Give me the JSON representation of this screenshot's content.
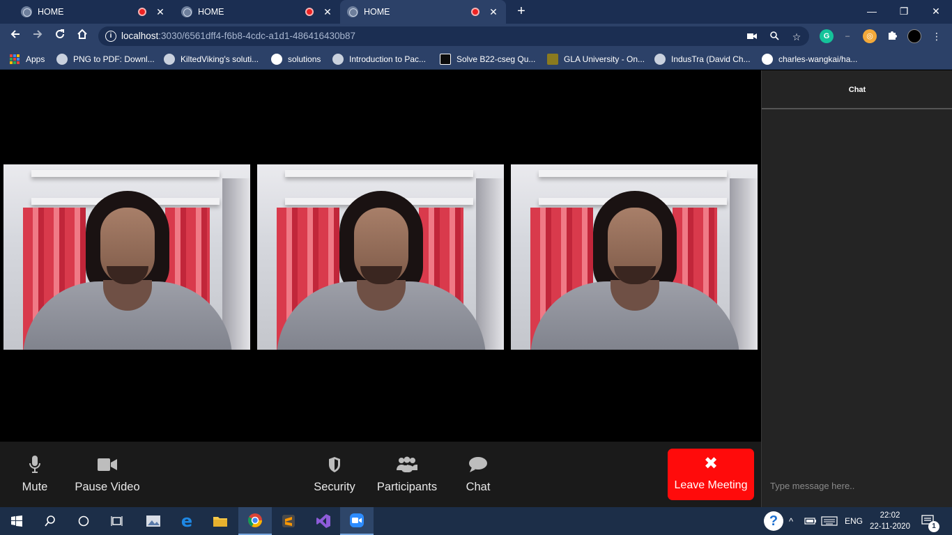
{
  "browser": {
    "tabs": [
      {
        "title": "HOME",
        "recording": true,
        "active": false
      },
      {
        "title": "HOME",
        "recording": true,
        "active": false
      },
      {
        "title": "HOME",
        "recording": true,
        "active": true
      }
    ],
    "new_tab_glyph": "+",
    "window_controls": {
      "minimize": "—",
      "restore": "❐",
      "close": "✕"
    },
    "address": {
      "host": "localhost",
      "rest": ":3030/6561dff4-f6b8-4cdc-a1d1-486416430b87"
    },
    "omnibox_icons": [
      "camera-icon",
      "zoom-icon",
      "star-icon"
    ],
    "extensions": [
      "grammarly-icon",
      "dash-icon",
      "glasses-icon",
      "puzzle-icon",
      "profile-avatar",
      "menu-icon"
    ],
    "bookmarks": [
      {
        "label": "Apps",
        "icon": "apps-grid-icon"
      },
      {
        "label": "PNG to PDF: Downl...",
        "icon": "globe-icon"
      },
      {
        "label": "KiltedViking's soluti...",
        "icon": "globe-icon"
      },
      {
        "label": "solutions",
        "icon": "github-icon"
      },
      {
        "label": "Introduction to Pac...",
        "icon": "globe-icon"
      },
      {
        "label": "Solve B22-cseg Qu...",
        "icon": "hackerrank-icon"
      },
      {
        "label": "GLA University - On...",
        "icon": "gla-icon"
      },
      {
        "label": "IndusTra (David Ch...",
        "icon": "globe-icon"
      },
      {
        "label": "charles-wangkai/ha...",
        "icon": "github-icon"
      }
    ]
  },
  "meeting": {
    "videos": [
      {
        "name": "video-tile-1"
      },
      {
        "name": "video-tile-2"
      },
      {
        "name": "video-tile-3"
      }
    ],
    "controls": {
      "mute": "Mute",
      "pause_video": "Pause Video",
      "security": "Security",
      "participants": "Participants",
      "chat": "Chat",
      "leave": "Leave Meeting",
      "leave_glyph": "✖"
    },
    "chat_panel": {
      "title": "Chat",
      "placeholder": "Type message here.."
    },
    "colors": {
      "leave_button": "#ff0b0b",
      "control_bar": "#1a1a1a",
      "chat_bg": "#242424"
    }
  },
  "taskbar": {
    "apps": [
      "windows-start-icon",
      "search-icon",
      "cortana-icon",
      "task-view-icon",
      "photos-icon",
      "edge-icon",
      "file-explorer-icon",
      "chrome-icon",
      "sublime-text-icon",
      "visual-studio-icon",
      "zoom-icon"
    ],
    "tray": {
      "language": "ENG",
      "notification_count": "1"
    },
    "clock": {
      "time": "22:02",
      "date": "22-11-2020"
    }
  }
}
